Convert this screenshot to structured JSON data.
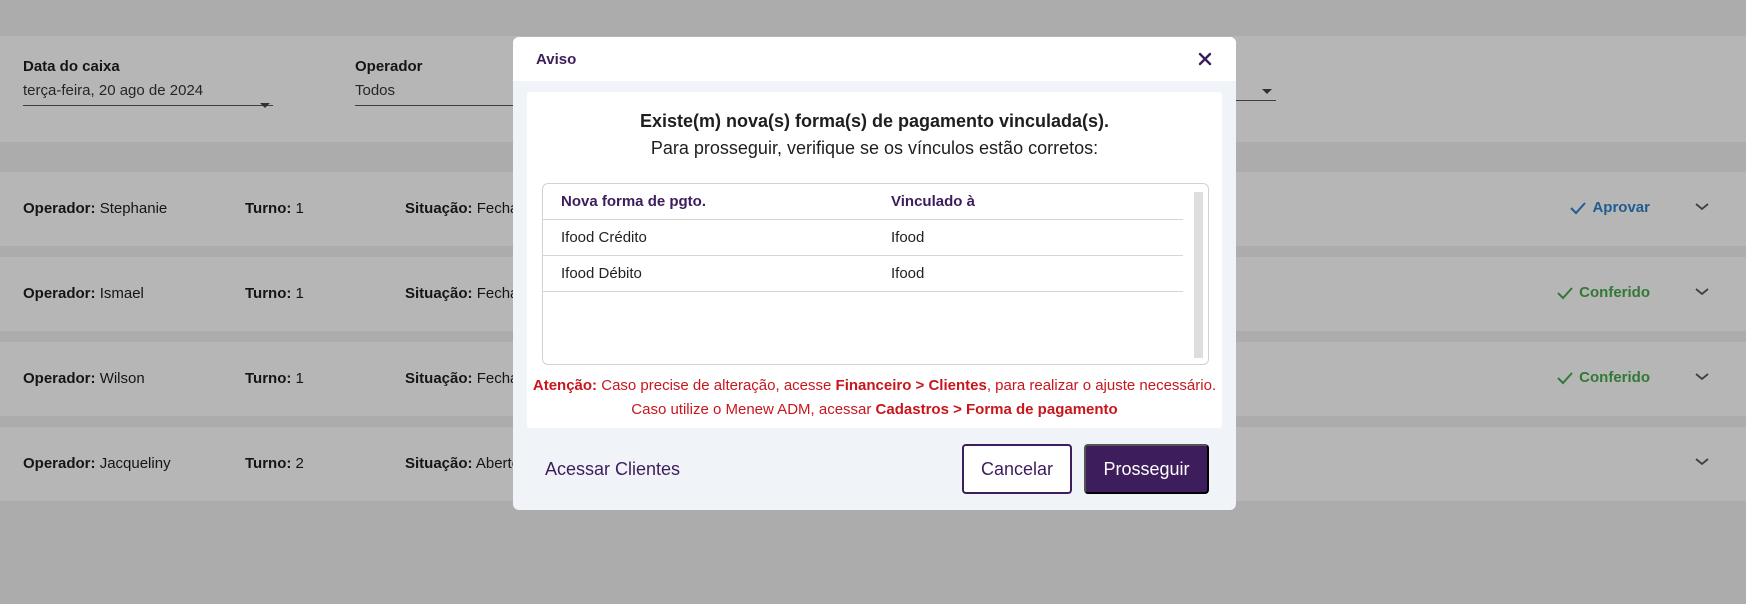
{
  "filters": {
    "date": {
      "label": "Data do caixa",
      "value": "terça-feira, 20 ago de 2024"
    },
    "operator": {
      "label": "Operador",
      "value": "Todos"
    }
  },
  "rows": [
    {
      "operator_label": "Operador:",
      "operator": "Stephanie",
      "shift_label": "Turno:",
      "shift": "1",
      "status_label": "Situação:",
      "status": "Fecha",
      "action": "Aprovar",
      "action_type": "approve"
    },
    {
      "operator_label": "Operador:",
      "operator": "Ismael",
      "shift_label": "Turno:",
      "shift": "1",
      "status_label": "Situação:",
      "status": "Fecha",
      "action": "Conferido",
      "action_type": "checked"
    },
    {
      "operator_label": "Operador:",
      "operator": "Wilson",
      "shift_label": "Turno:",
      "shift": "1",
      "status_label": "Situação:",
      "status": "Fecha",
      "action": "Conferido",
      "action_type": "checked"
    },
    {
      "operator_label": "Operador:",
      "operator": "Jacqueliny",
      "shift_label": "Turno:",
      "shift": "2",
      "status_label": "Situação:",
      "status": "Aberto",
      "action": "",
      "action_type": "none"
    }
  ],
  "modal": {
    "title": "Aviso",
    "message_line1": "Existe(m) nova(s) forma(s) de pagamento vinculada(s).",
    "message_line2": "Para prosseguir, verifique se os vínculos estão corretos:",
    "table": {
      "headers": [
        "Nova forma de pgto.",
        "Vinculado à"
      ],
      "rows": [
        [
          "Ifood Crédito",
          "Ifood"
        ],
        [
          "Ifood Débito",
          "Ifood"
        ]
      ]
    },
    "warning": {
      "prefix": "Atenção:",
      "text1": " Caso precise de alteração, acesse ",
      "path1": "Financeiro > Clientes",
      "text2": ", para realizar o ajuste necessário.",
      "text3": "Caso utilize o Menew ADM, acessar ",
      "path2": "Cadastros > Forma de pagamento"
    },
    "link_label": "Acessar Clientes",
    "cancel_label": "Cancelar",
    "proceed_label": "Prosseguir"
  },
  "colors": {
    "brand": "#3d1d5c",
    "approve": "#2f7ec7",
    "checked": "#46a64a",
    "warning": "#c8161d"
  }
}
